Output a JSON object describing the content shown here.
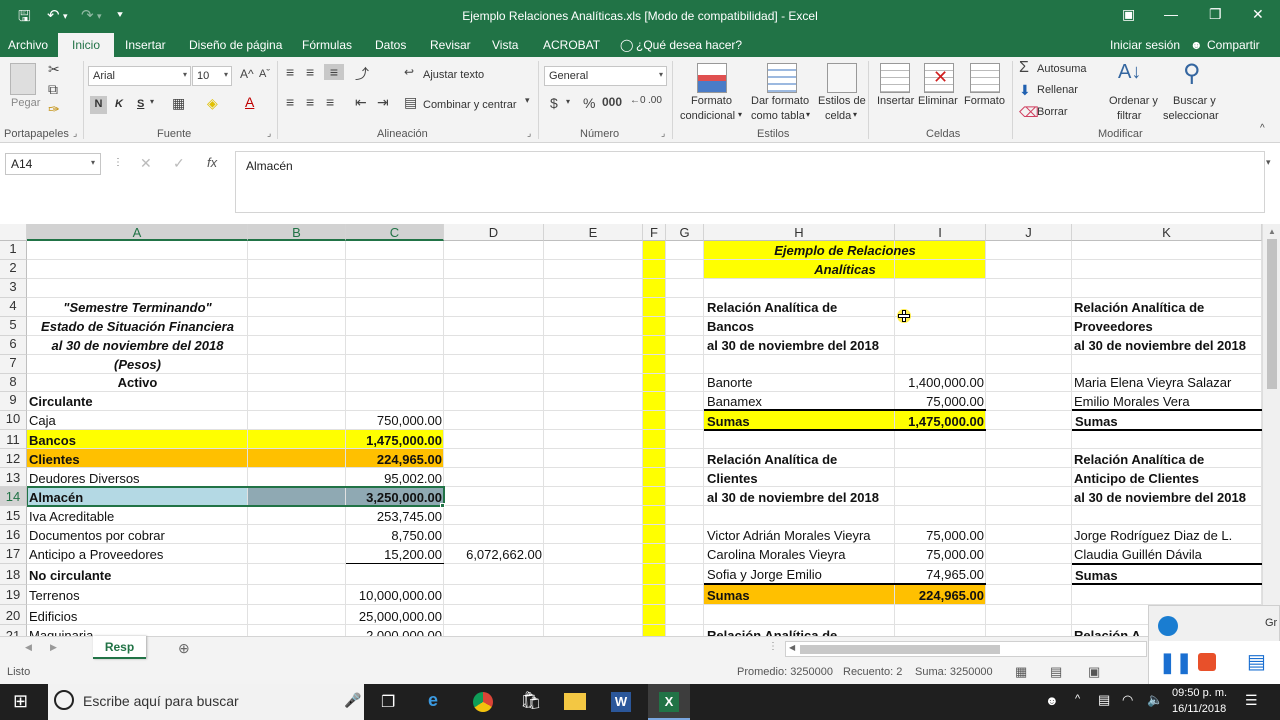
{
  "window": {
    "title": "Ejemplo Relaciones Analíticas.xls  [Modo de compatibilidad] - Excel",
    "accent": "#217346"
  },
  "menu": {
    "tabs": [
      "Archivo",
      "Inicio",
      "Insertar",
      "Diseño de página",
      "Fórmulas",
      "Datos",
      "Revisar",
      "Vista",
      "ACROBAT"
    ],
    "tell_me": "¿Qué desea hacer?",
    "sign_in": "Iniciar sesión",
    "share": "Compartir"
  },
  "ribbon": {
    "paste": "Pegar",
    "portapapeles": "Portapapeles",
    "font_name": "Arial",
    "font_size": "10",
    "fuente": "Fuente",
    "bold": "N",
    "italic": "K",
    "underline": "S",
    "wrap_text": "Ajustar texto",
    "merge_center": "Combinar y centrar",
    "alineacion": "Alineación",
    "number_format": "General",
    "numero": "Número",
    "cond_format_1": "Formato",
    "cond_format_2": "condicional",
    "format_table_1": "Dar formato",
    "format_table_2": "como tabla",
    "cell_styles_1": "Estilos de",
    "cell_styles_2": "celda",
    "estilos": "Estilos",
    "insert": "Insertar",
    "delete": "Eliminar",
    "format": "Formato",
    "celdas": "Celdas",
    "autosum": "Autosuma",
    "fill": "Rellenar",
    "clear": "Borrar",
    "sort_1": "Ordenar y",
    "sort_2": "filtrar",
    "find_1": "Buscar y",
    "find_2": "seleccionar",
    "modificar": "Modificar"
  },
  "formula_bar": {
    "name_box": "A14",
    "fx": "fx",
    "content": "Almacén"
  },
  "columns": [
    "A",
    "B",
    "C",
    "D",
    "E",
    "F",
    "G",
    "H",
    "I",
    "J",
    "K"
  ],
  "rows": [
    "1",
    "2",
    "3",
    "4",
    "5",
    "6",
    "7",
    "8",
    "9",
    "10",
    "11",
    "12",
    "13",
    "14",
    "15",
    "16",
    "17",
    "18",
    "19",
    "20",
    "21"
  ],
  "sheet": {
    "h1_title_1": "Ejemplo de Relaciones",
    "h1_title_2": "Analíticas",
    "a4": "\"Semestre Terminando\"",
    "a5": "Estado de Situación Financiera",
    "a6": "al 30 de noviembre del 2018",
    "a7": "(Pesos)",
    "a8": "Activo",
    "a9": "Circulante",
    "a10": "Caja",
    "c10": "750,000.00",
    "a11": "Bancos",
    "c11": "1,475,000.00",
    "a12": "Clientes",
    "c12": "224,965.00",
    "a13": "Deudores Diversos",
    "c13": "95,002.00",
    "a14": "Almacén",
    "c14": "3,250,000.00",
    "a15": "Iva Acreditable",
    "c15": "253,745.00",
    "a16": "Documentos por cobrar",
    "c16": "8,750.00",
    "a17": "Anticipo a Proveedores",
    "c17": "15,200.00",
    "d17": "6,072,662.00",
    "a18": "No circulante",
    "a19": "Terrenos",
    "c19": "10,000,000.00",
    "a20": "Edificios",
    "c20": "25,000,000.00",
    "a21": "Maquinaria",
    "c21": "2,000,000.00",
    "h4": "Relación Analítica de",
    "h5": "Bancos",
    "h6": "al 30 de noviembre del 2018",
    "h8": "Banorte",
    "i8": "1,400,000.00",
    "h9": "Banamex",
    "i9": "75,000.00",
    "h10": "Sumas",
    "i10": "1,475,000.00",
    "h12": "Relación Analítica de",
    "h13": "Clientes",
    "h14": "al 30 de noviembre del 2018",
    "h16": "Victor Adrián Morales Vieyra",
    "i16": "75,000.00",
    "h17": "Carolina Morales Vieyra",
    "i17": "75,000.00",
    "h18": "Sofia y Jorge Emilio",
    "i18": "74,965.00",
    "h19": "Sumas",
    "i19": "224,965.00",
    "h21": "Relación Analítica de",
    "k4": "Relación Analítica de",
    "k5": "Proveedores",
    "k6": "al 30 de noviembre del 2018",
    "k8": "Maria Elena Vieyra Salazar",
    "k9": "Emilio Morales Vera",
    "k10": "Sumas",
    "k12": "Relación Analítica de",
    "k13": "Anticipo de Clientes",
    "k14": "al 30 de noviembre del 2018",
    "k16": "Jorge Rodríguez Diaz de L.",
    "k17": "Claudia Guillén Dávila",
    "k18": "Sumas",
    "k21": "Relación A"
  },
  "sheet_tab": "Resp",
  "status": {
    "mode": "Listo",
    "average": "Promedio: 3250000",
    "count": "Recuento: 2",
    "sum": "Suma: 3250000"
  },
  "taskbar": {
    "search_placeholder": "Escribe aquí para buscar",
    "time": "09:50 p. m.",
    "date": "16/11/2018"
  },
  "recorder": {
    "label": "Gr"
  },
  "colors": {
    "yellow": "#ffff00",
    "orange": "#ffc000",
    "selection": "#b4d9e4",
    "selection_dark": "#8fa9b3"
  }
}
